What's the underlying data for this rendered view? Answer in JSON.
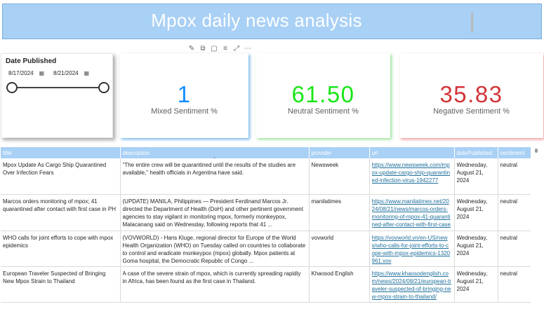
{
  "banner": {
    "title": "Mpox daily news analysis"
  },
  "visual_header": {
    "icons": [
      "pin-icon",
      "copy-icon",
      "comment-icon",
      "filter-icon",
      "focus-mode-icon",
      "more-options-icon"
    ]
  },
  "slicer": {
    "title": "Date Published",
    "start_date": "8/17/2024",
    "end_date": "8/21/2024"
  },
  "kpis": [
    {
      "value": "1",
      "label": "Mixed Sentiment %",
      "color": "#118dff"
    },
    {
      "value": "61.50",
      "label": "Neutral Sentiment %",
      "color": "#19e619"
    },
    {
      "value": "35.83",
      "label": "Negative Sentiment %",
      "color": "#d13438"
    }
  ],
  "table": {
    "columns": [
      "title",
      "description",
      "provider",
      "url",
      "datePublished",
      "sentiment"
    ],
    "rows": [
      {
        "title": "Mpox Update As Cargo Ship Quarantined Over Infection Fears",
        "description": "\"The entire crew will be quarantined until the results of the studies are available,\" health officials in Argentina have said.",
        "provider": "Newsweek",
        "url": "https://www.newsweek.com/mpox-update-cargo-ship-quarantined-infection-virus-1942277",
        "datePublished": "Wednesday, August 21, 2024",
        "sentiment": "neutral"
      },
      {
        "title": "Marcos orders monitoring of mpox; 41 quarantined after contact with first case in PH",
        "description": "(UPDATE) MANILA, Philippines — President Ferdinand Marcos Jr. directed the Department of Health (DoH) and other pertinent government agencies to stay vigilant in monitoring mpox, formerly monkeypox, Malacanang said on Wednesday, following reports that 41 ...",
        "provider": "manilatimes",
        "url": "https://www.manilatimes.net/2024/08/21/news/marcos-orders-monitoring-of-mpox-41-quarantined-after-contact-with-first-case-in-ph/1965682",
        "datePublished": "Wednesday, August 21, 2024",
        "sentiment": "neutral"
      },
      {
        "title": "WHO calls for joint efforts to cope with mpox epidemics",
        "description": "(VOVWORLD) - Hans Kluge, regional director for Europe of the World Health Organization (WHO) on Tuesday called on countries to collaborate to control and eradicate monkeypox (mpox) globally. Mpox patients at Goma hospital, the Democratic Republic of Congo ...",
        "provider": "vovworld",
        "url": "https://vovworld.vn/en-US/news/who-calls-for-joint-efforts-to-cope-with-mpox-epidemics-1320961.vov",
        "datePublished": "Wednesday, August 21, 2024",
        "sentiment": "neutral"
      },
      {
        "title": "European Traveler Suspected of Bringing New Mpox Strain to Thailand",
        "description": "A case of the severe strain of mpox, which is currently spreading rapidly in Africa, has been found as the first case in Thailand.",
        "provider": "Khaosod English",
        "url": "https://www.khaosodenglish.com/news/2024/08/21/european-traveler-suspected-of-bringing-new-mpox-strain-to-thailand/",
        "datePublished": "Wednesday, August 21, 2024",
        "sentiment": "neutral"
      }
    ]
  }
}
